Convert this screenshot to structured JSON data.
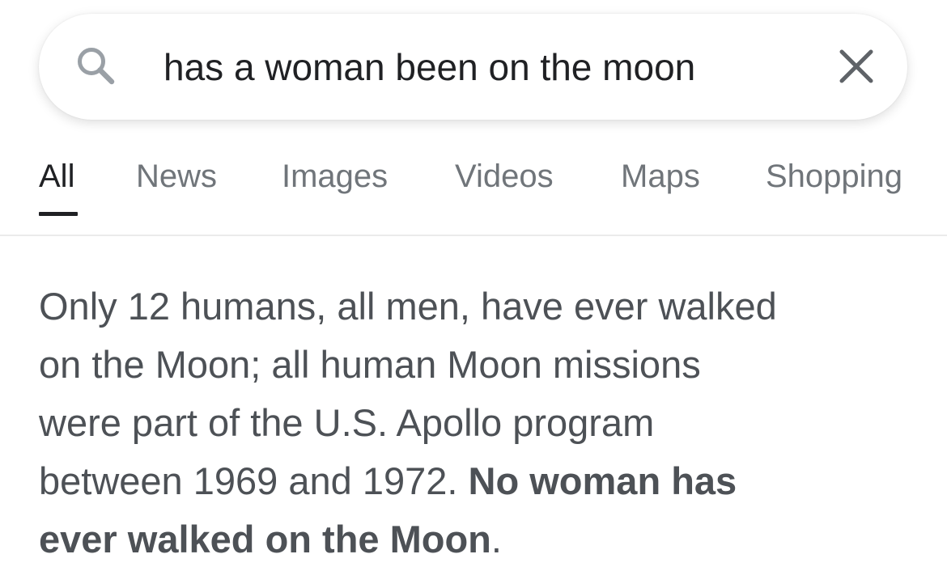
{
  "search": {
    "query": "has a woman been on the moon",
    "search_icon": "search-icon",
    "clear_icon": "close-icon"
  },
  "tabs": [
    {
      "label": "All",
      "active": true
    },
    {
      "label": "News",
      "active": false
    },
    {
      "label": "Images",
      "active": false
    },
    {
      "label": "Videos",
      "active": false
    },
    {
      "label": "Maps",
      "active": false
    },
    {
      "label": "Shopping",
      "active": false
    }
  ],
  "answer": {
    "line1": "Only 12 humans, all men, have ever walked",
    "line2": "on the Moon; all human Moon missions",
    "line3": "were part of the U.S. Apollo program",
    "line4_plain": "between 1969 and 1972. ",
    "line4_bold": "No woman has",
    "line5_bold": "ever walked on the Moon",
    "line5_plain": "."
  },
  "colors": {
    "text_primary": "#202124",
    "text_secondary": "#70757a",
    "answer_text": "#4d5156",
    "divider": "#ebebeb"
  }
}
